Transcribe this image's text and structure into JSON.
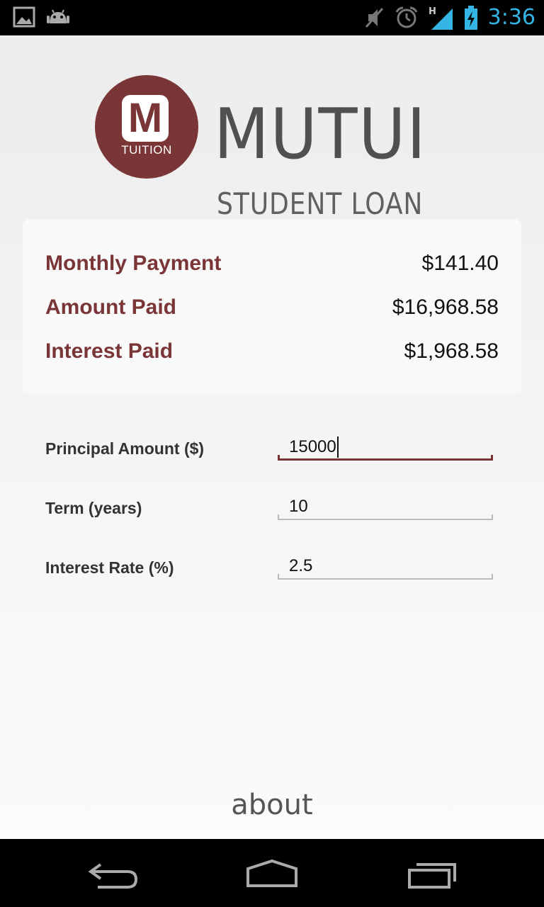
{
  "status_bar": {
    "time": "3:36",
    "network": "H",
    "icons": [
      "picture-icon",
      "android-icon",
      "mute-icon",
      "alarm-icon",
      "signal-icon",
      "battery-charging-icon"
    ]
  },
  "logo": {
    "mark_letter": "M",
    "mark_subtitle": "TUITION",
    "title": "MUTUI",
    "tagline": "STUDENT LOAN"
  },
  "results": [
    {
      "label": "Monthly Payment",
      "value": "$141.40"
    },
    {
      "label": "Amount Paid",
      "value": "$16,968.58"
    },
    {
      "label": "Interest Paid",
      "value": "$1,968.58"
    }
  ],
  "form": [
    {
      "label": "Principal Amount ($)",
      "value": "15000",
      "focused": true
    },
    {
      "label": "Term (years)",
      "value": "10",
      "focused": false
    },
    {
      "label": "Interest Rate (%)",
      "value": "2.5",
      "focused": false
    }
  ],
  "about_link": "about",
  "nav": {
    "icons": [
      "back-icon",
      "home-icon",
      "recent-apps-icon"
    ]
  },
  "colors": {
    "accent": "#7a3537",
    "status_blue": "#33b5e5"
  }
}
